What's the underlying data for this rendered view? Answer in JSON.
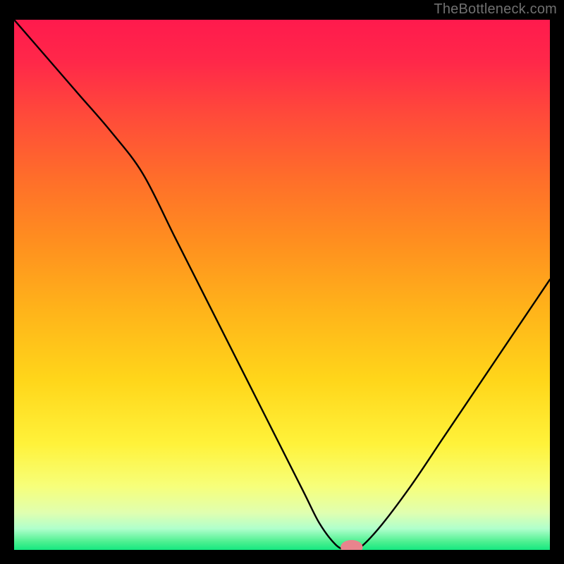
{
  "watermark": "TheBottleneck.com",
  "colors": {
    "frame": "#000000",
    "gradient_stops": [
      {
        "offset": 0.0,
        "color": "#ff1a4d"
      },
      {
        "offset": 0.08,
        "color": "#ff2849"
      },
      {
        "offset": 0.18,
        "color": "#ff4a3a"
      },
      {
        "offset": 0.3,
        "color": "#ff6e2a"
      },
      {
        "offset": 0.42,
        "color": "#ff8f1f"
      },
      {
        "offset": 0.55,
        "color": "#ffb41a"
      },
      {
        "offset": 0.68,
        "color": "#ffd61a"
      },
      {
        "offset": 0.8,
        "color": "#fff23a"
      },
      {
        "offset": 0.88,
        "color": "#f7ff7a"
      },
      {
        "offset": 0.93,
        "color": "#e0ffb0"
      },
      {
        "offset": 0.96,
        "color": "#b0ffcc"
      },
      {
        "offset": 0.985,
        "color": "#4cf090"
      },
      {
        "offset": 1.0,
        "color": "#15e880"
      }
    ],
    "curve": "#000000",
    "marker_fill": "#e8848d",
    "marker_stroke": "#e8848d"
  },
  "chart_data": {
    "type": "line",
    "title": "",
    "xlabel": "",
    "ylabel": "",
    "xlim": [
      0,
      100
    ],
    "ylim": [
      0,
      100
    ],
    "grid": false,
    "legend": false,
    "series": [
      {
        "name": "bottleneck-curve",
        "x": [
          0,
          6,
          12,
          18,
          24,
          30,
          36,
          42,
          48,
          54,
          57,
          60,
          62,
          64,
          68,
          74,
          80,
          86,
          92,
          100
        ],
        "values": [
          100,
          93,
          86,
          79,
          71,
          59,
          47,
          35,
          23,
          11,
          5,
          1,
          0,
          0,
          4,
          12,
          21,
          30,
          39,
          51
        ]
      }
    ],
    "marker": {
      "x": 63,
      "y": 0.5,
      "rx": 2.0,
      "ry": 1.3
    }
  }
}
